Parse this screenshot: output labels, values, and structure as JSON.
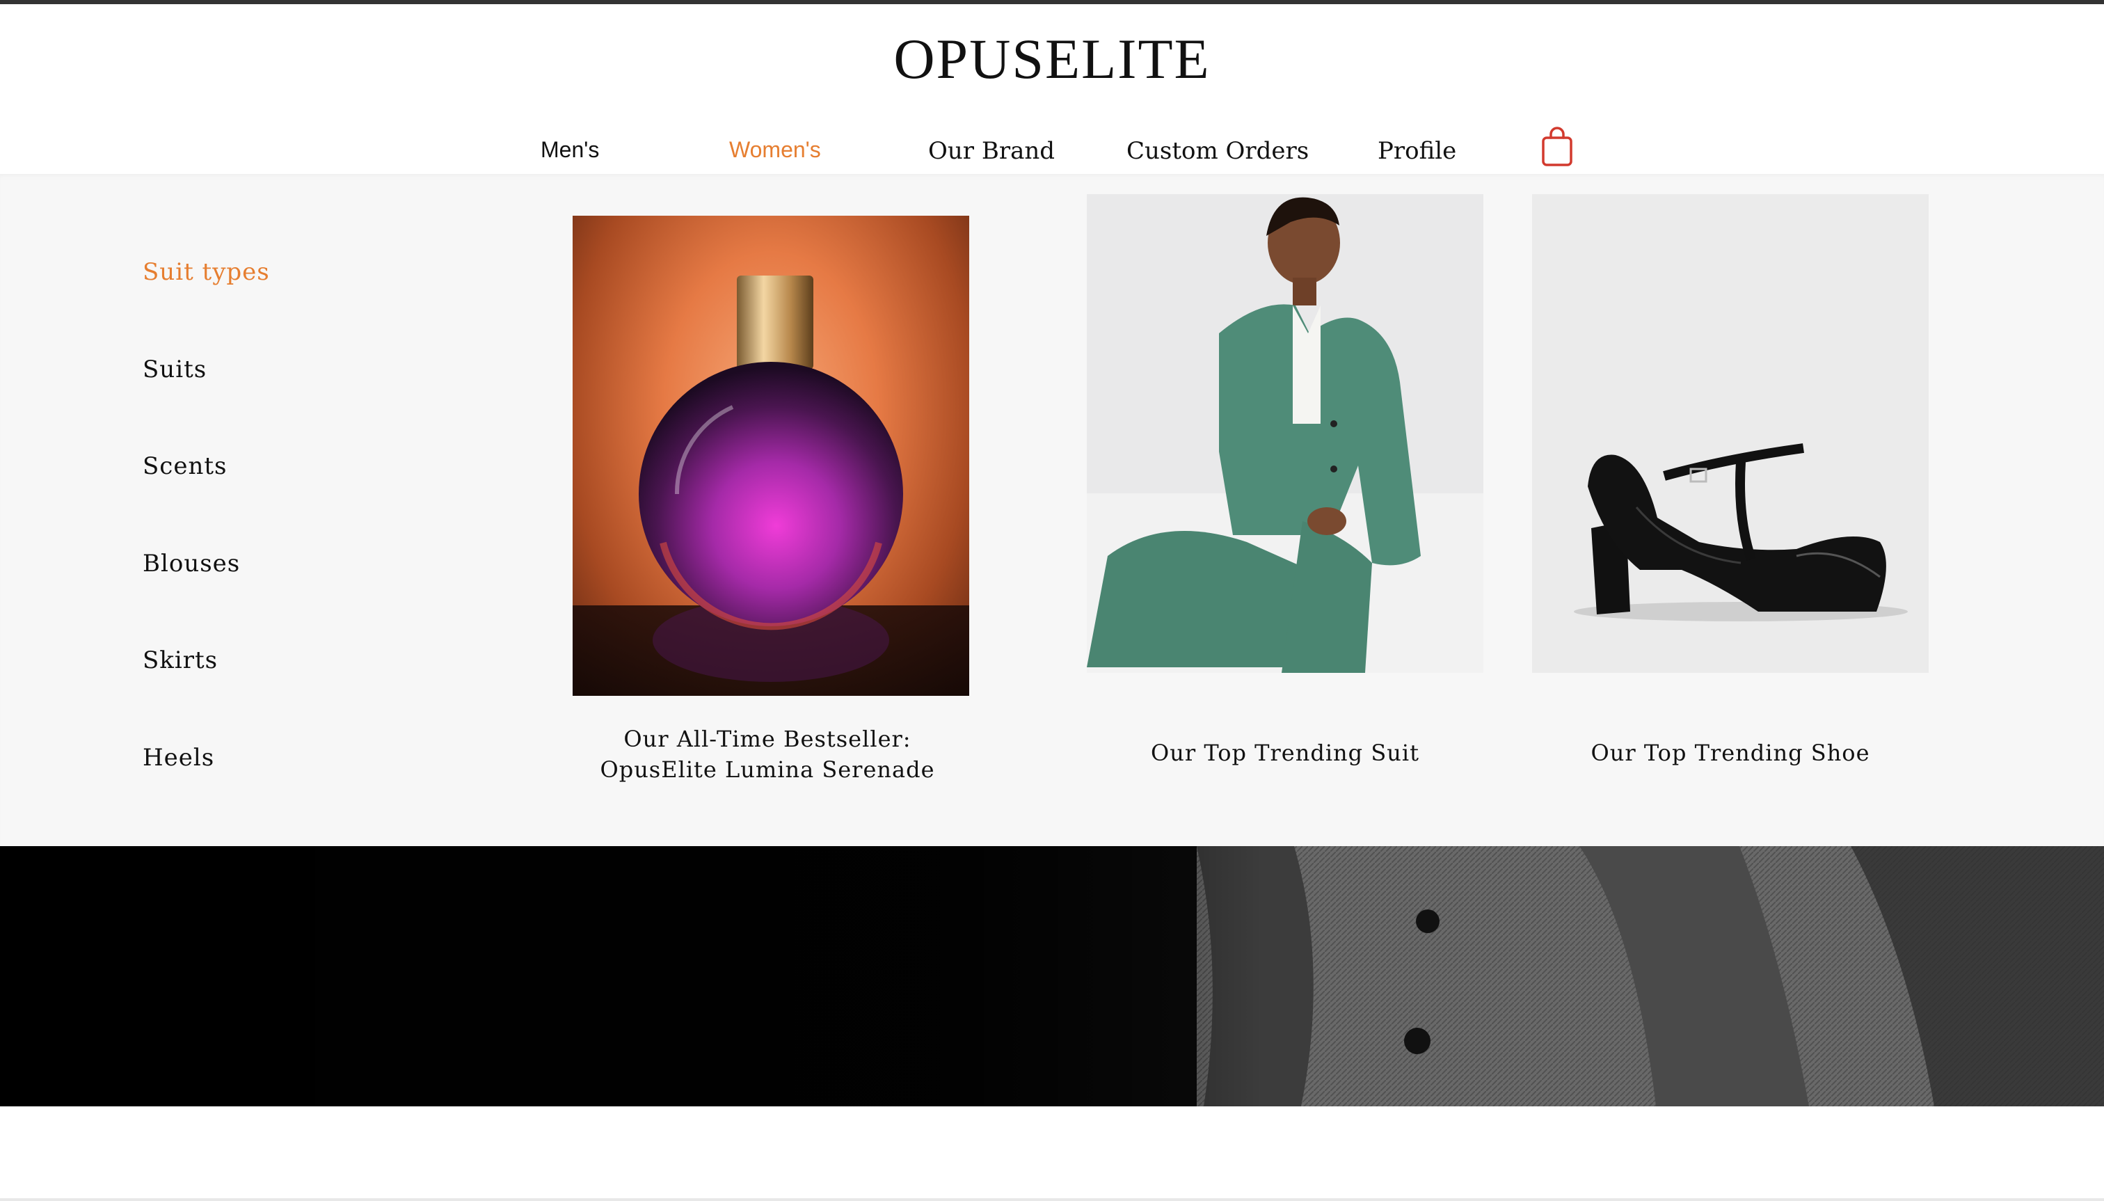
{
  "brand": {
    "logo": "OPUSELITE"
  },
  "nav": {
    "items": [
      {
        "label": "Men's"
      },
      {
        "label": "Women's"
      },
      {
        "label": "Our Brand"
      },
      {
        "label": "Custom Orders"
      },
      {
        "label": "Profile"
      }
    ],
    "active_item": "Women's",
    "cart_icon": "shopping-bag-icon"
  },
  "menu": {
    "categories": [
      {
        "label": "Suit types"
      },
      {
        "label": "Suits"
      },
      {
        "label": "Scents"
      },
      {
        "label": "Blouses"
      },
      {
        "label": "Skirts"
      },
      {
        "label": "Heels"
      }
    ],
    "active_category": "Suit types",
    "featured": [
      {
        "caption_line1": "Our All-Time Bestseller:",
        "caption_line2": "OpusElite Lumina Serenade",
        "image": "perfume-bottle"
      },
      {
        "caption": "Our Top Trending Suit",
        "image": "woman-in-green-suit"
      },
      {
        "caption": "Our Top Trending Shoe",
        "image": "black-t-strap-heel"
      }
    ]
  },
  "colors": {
    "accent": "#e67e30",
    "text": "#111111",
    "panel_bg": "#f7f7f7"
  }
}
